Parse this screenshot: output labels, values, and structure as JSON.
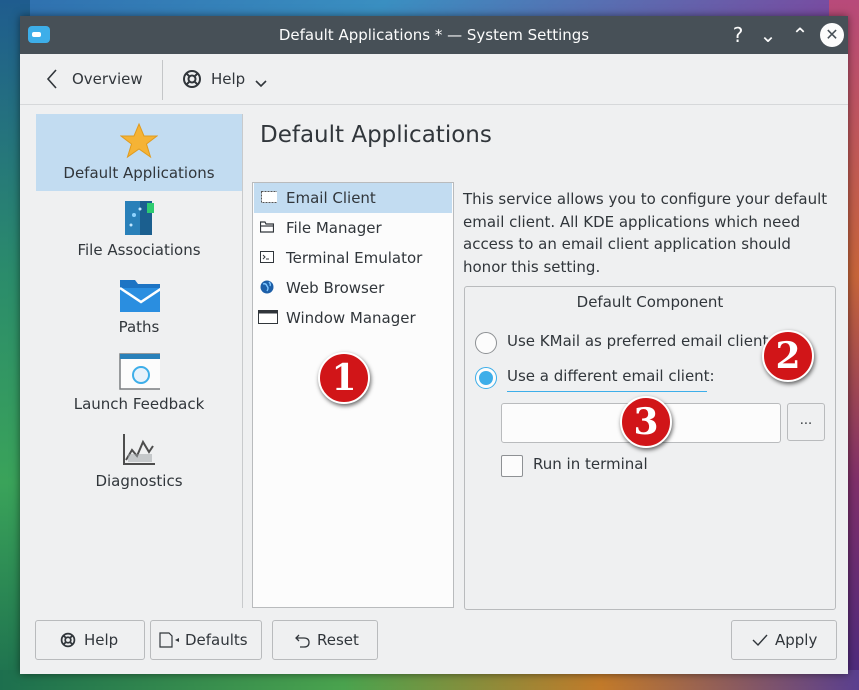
{
  "window": {
    "title": "Default Applications * — System Settings",
    "help_glyph": "?",
    "minimize_glyph": "⌄",
    "maximize_glyph": "⌃",
    "close_glyph": "✕"
  },
  "toolbar": {
    "overview_label": "Overview",
    "help_label": "Help"
  },
  "sidebar": {
    "items": [
      {
        "label": "Default Applications",
        "icon": "star-icon",
        "selected": true
      },
      {
        "label": "File Associations",
        "icon": "file-associations-icon"
      },
      {
        "label": "Paths",
        "icon": "folder-icon"
      },
      {
        "label": "Launch Feedback",
        "icon": "launch-feedback-icon"
      },
      {
        "label": "Diagnostics",
        "icon": "diagnostics-icon"
      }
    ]
  },
  "main": {
    "page_title": "Default Applications",
    "components": [
      {
        "label": "Email Client",
        "icon": "email-client-icon",
        "selected": true
      },
      {
        "label": "File Manager",
        "icon": "file-manager-icon"
      },
      {
        "label": "Terminal Emulator",
        "icon": "terminal-icon"
      },
      {
        "label": "Web Browser",
        "icon": "globe-icon"
      },
      {
        "label": "Window Manager",
        "icon": "window-icon"
      }
    ],
    "description": "This service allows you to configure your default email client. All KDE applications which need access to an email client application should honor this setting.",
    "group_title": "Default Component",
    "option_kmail": "Use KMail as preferred email client",
    "option_different": "Use a different email client:",
    "selected_option": "different",
    "client_input_value": "",
    "browse_label": "...",
    "run_in_terminal_label": "Run in terminal",
    "run_in_terminal_checked": false
  },
  "annotations": [
    "1",
    "2",
    "3"
  ],
  "buttons": {
    "help": "Help",
    "defaults": "Defaults",
    "reset": "Reset",
    "apply": "Apply"
  },
  "colors": {
    "accent": "#3daee9",
    "selection": "#c2dcf1",
    "titlebar": "#475057",
    "badge": "#d11518"
  }
}
